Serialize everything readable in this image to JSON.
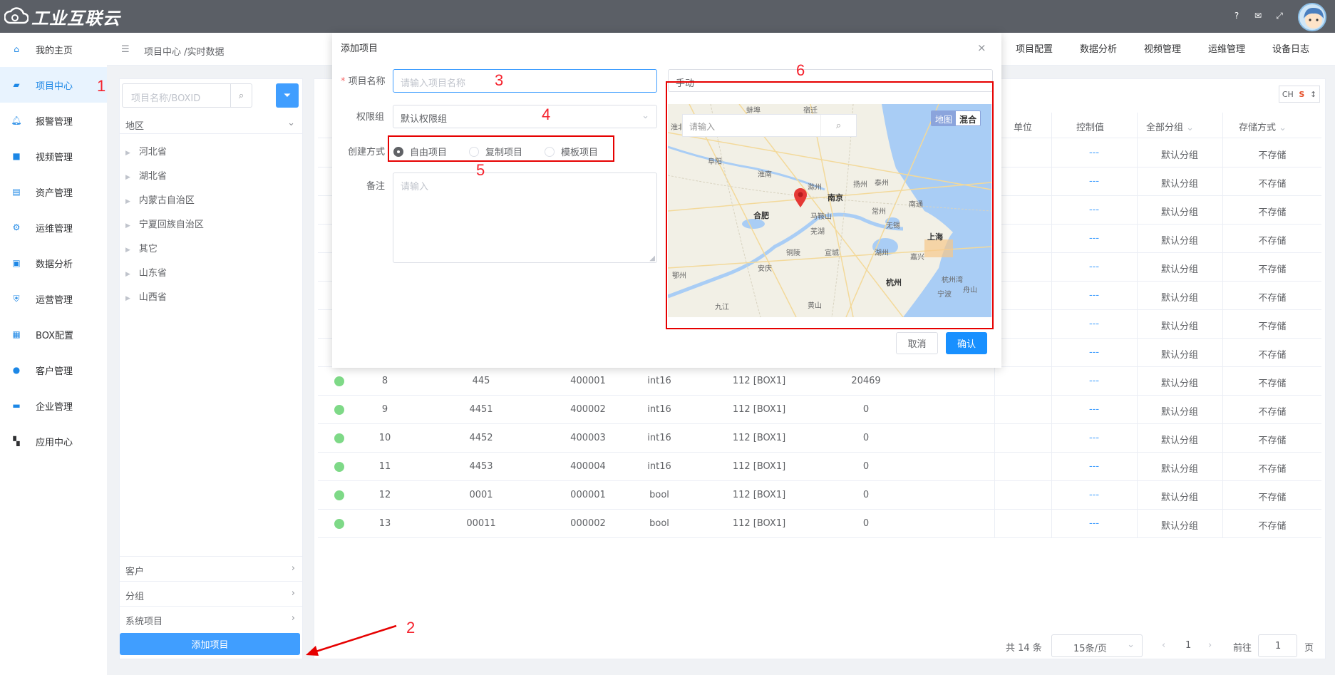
{
  "app": {
    "logo_text": "工业互联云"
  },
  "sidebar": {
    "items": [
      {
        "label": "我的主页",
        "icon": "home-icon"
      },
      {
        "label": "项目中心",
        "icon": "project-icon"
      },
      {
        "label": "报警管理",
        "icon": "bell-icon"
      },
      {
        "label": "视频管理",
        "icon": "video-icon"
      },
      {
        "label": "资产管理",
        "icon": "asset-icon"
      },
      {
        "label": "运维管理",
        "icon": "gear-icon"
      },
      {
        "label": "数据分析",
        "icon": "chart-icon"
      },
      {
        "label": "运营管理",
        "icon": "shield-icon"
      },
      {
        "label": "BOX配置",
        "icon": "box-icon"
      },
      {
        "label": "客户管理",
        "icon": "users-icon"
      },
      {
        "label": "企业管理",
        "icon": "briefcase-icon"
      },
      {
        "label": "应用中心",
        "icon": "grid-icon"
      }
    ]
  },
  "breadcrumb": "项目中心 /实时数据",
  "topnav": [
    "项目配置",
    "数据分析",
    "视频管理",
    "运维管理",
    "设备日志"
  ],
  "left": {
    "search_placeholder": "项目名称/BOXID",
    "region_title": "地区",
    "regions": [
      "河北省",
      "湖北省",
      "内蒙古自治区",
      "宁夏回族自治区",
      "其它",
      "山东省",
      "山西省"
    ],
    "accordions": [
      "客户",
      "分组",
      "系统项目"
    ],
    "add_button": "添加项目"
  },
  "table": {
    "headers": {
      "unit": "单位",
      "control": "控制值",
      "group": "全部分组",
      "storage": "存储方式"
    },
    "top_rows": [
      {
        "control": "---",
        "group": "默认分组",
        "storage": "不存储"
      },
      {
        "control": "---",
        "group": "默认分组",
        "storage": "不存储"
      },
      {
        "control": "---",
        "group": "默认分组",
        "storage": "不存储"
      },
      {
        "control": "---",
        "group": "默认分组",
        "storage": "不存储"
      },
      {
        "control": "---",
        "group": "默认分组",
        "storage": "不存储"
      },
      {
        "control": "---",
        "group": "默认分组",
        "storage": "不存储"
      },
      {
        "control": "---",
        "group": "默认分组",
        "storage": "不存储"
      },
      {
        "control": "---",
        "group": "默认分组",
        "storage": "不存储"
      }
    ],
    "rows": [
      {
        "no": "8",
        "name": "445",
        "addr": "400001",
        "type": "int16",
        "box": "112 [BOX1]",
        "value": "20469",
        "control": "---",
        "group": "默认分组",
        "storage": "不存储"
      },
      {
        "no": "9",
        "name": "4451",
        "addr": "400002",
        "type": "int16",
        "box": "112 [BOX1]",
        "value": "0",
        "control": "---",
        "group": "默认分组",
        "storage": "不存储"
      },
      {
        "no": "10",
        "name": "4452",
        "addr": "400003",
        "type": "int16",
        "box": "112 [BOX1]",
        "value": "0",
        "control": "---",
        "group": "默认分组",
        "storage": "不存储"
      },
      {
        "no": "11",
        "name": "4453",
        "addr": "400004",
        "type": "int16",
        "box": "112 [BOX1]",
        "value": "0",
        "control": "---",
        "group": "默认分组",
        "storage": "不存储"
      },
      {
        "no": "12",
        "name": "0001",
        "addr": "000001",
        "type": "bool",
        "box": "112 [BOX1]",
        "value": "0",
        "control": "---",
        "group": "默认分组",
        "storage": "不存储"
      },
      {
        "no": "13",
        "name": "00011",
        "addr": "000002",
        "type": "bool",
        "box": "112 [BOX1]",
        "value": "0",
        "control": "---",
        "group": "默认分组",
        "storage": "不存储"
      }
    ]
  },
  "pager": {
    "total": "共 14 条",
    "page_size": "15条/页",
    "current": "1",
    "goto_label": "前往",
    "goto_value": "1",
    "page_unit": "页"
  },
  "lang": "CH",
  "dialog": {
    "title": "添加项目",
    "name_label": "项目名称",
    "name_placeholder": "请输入项目名称",
    "perm_label": "权限组",
    "perm_value": "默认权限组",
    "create_label": "创建方式",
    "options": [
      "自由项目",
      "复制项目",
      "模板项目"
    ],
    "remark_label": "备注",
    "remark_placeholder": "请输入",
    "locate_mode": "手动",
    "map": {
      "search_placeholder": "请输入",
      "type_map": "地图",
      "type_hybrid": "混合",
      "cities": [
        "南京",
        "合肥",
        "上海",
        "杭州",
        "杭州湾",
        "马鞍山",
        "芜湖",
        "宣城",
        "铜陵",
        "安庆",
        "常州",
        "无锡",
        "湖州",
        "嘉兴",
        "宁波",
        "舟山",
        "南通",
        "泰州",
        "扬州",
        "淮南",
        "阜阳",
        "蚌埠",
        "滁州",
        "黄山",
        "九江",
        "鄂州",
        "宿迁",
        "淮北"
      ]
    },
    "cancel": "取消",
    "confirm": "确认"
  },
  "annotations": [
    "1",
    "2",
    "3",
    "4",
    "5",
    "6"
  ]
}
